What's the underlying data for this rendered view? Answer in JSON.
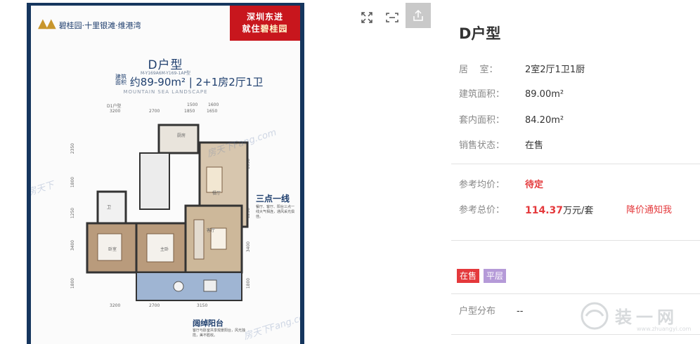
{
  "viewer": {
    "brochure": {
      "logo_text": "碧桂园·十里银滩·维港湾",
      "promo_line1": "深圳东进",
      "promo_line2_prefix": "就住",
      "promo_line2_highlight": "碧桂园",
      "plan_title": "D户型",
      "plan_model": "M-Y169A6M-Y169-1AP型",
      "area_prefix": "建筑\n面积",
      "area_text": "约89-90m² | 2+1房2厅1卫",
      "plan_en": "MOUNTAIN SEA LANDSCAPE",
      "callout_title": "三点一线",
      "callout_text": "餐厅、客厅、阳台三点一线大气相连，通风采光俱佳。",
      "balcony_title": "阔绰阳台",
      "balcony_text": "客厅与卧室共享观景阳台，风光独揽，美不胜收。",
      "dims_top": [
        "3200",
        "2700",
        "1850",
        "1650"
      ],
      "dims_top_sub": [
        "D1户型",
        "1500",
        "1600"
      ],
      "dims_bottom": [
        "3200",
        "2700",
        "3150"
      ],
      "dims_left": [
        "2350",
        "1800",
        "1250",
        "3400",
        "1800"
      ],
      "dims_right": [
        "1650",
        "1250",
        "3400",
        "1800"
      ],
      "room_labels": [
        "餐厅",
        "客厅",
        "卧室",
        "主卧",
        "厨房",
        "卫"
      ],
      "watermarks": [
        "房天下",
        "房天下Fang.com",
        "房天下Fang.com"
      ]
    },
    "tools": {
      "fullscreen_icon": "expand-icon",
      "fit_icon": "fit-screen-icon",
      "share_icon": "share-icon"
    }
  },
  "panel": {
    "title": "D户型",
    "rooms_label": "居    室：",
    "rooms_value": "2室2厅1卫1厨",
    "build_area_label": "建筑面积：",
    "build_area_value": "89.00m²",
    "inner_area_label": "套内面积：",
    "inner_area_value": "84.20m²",
    "sale_status_label": "销售状态：",
    "sale_status_value": "在售",
    "ref_unit_price_label": "参考均价：",
    "ref_unit_price_value": "待定",
    "ref_total_price_label": "参考总价：",
    "ref_total_price_number": "114.37",
    "ref_total_price_unit": "万元/套",
    "price_drop_notify": "降价通知我",
    "badges": [
      "在售",
      "平层"
    ],
    "distribution_label": "户型分布",
    "distribution_value": "--"
  },
  "brand_watermark": {
    "text": "装一网",
    "sub": "www.zhuangyi.com"
  },
  "colors": {
    "accent_red": "#e4393c",
    "badge_purple": "#b59ad8",
    "brochure_navy": "#16365e"
  }
}
